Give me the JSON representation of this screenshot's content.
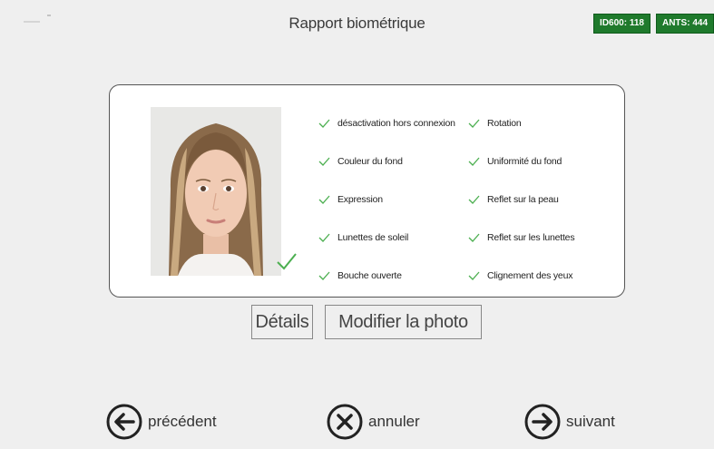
{
  "header": {
    "title": "Rapport biométrique",
    "badges": [
      "ID600: 118",
      "ANTS: 444"
    ]
  },
  "photo": {
    "alt": "portrait-photo",
    "validated": true
  },
  "checks": [
    "désactivation hors connexion",
    "Rotation",
    "Couleur du fond",
    "Uniformité du fond",
    "Expression",
    "Reflet sur la peau",
    "Lunettes de soleil",
    "Reflet sur les lunettes",
    "Bouche ouverte",
    "Clignement des yeux"
  ],
  "actions": {
    "details_label": "Détails",
    "modify_label": "Modifier la photo"
  },
  "nav": {
    "prev_label": "précédent",
    "cancel_label": "annuler",
    "next_label": "suivant"
  },
  "colors": {
    "accent_green": "#1f7a2c",
    "check_green": "#4caf50",
    "background": "#efefef"
  },
  "icons": {
    "prev": "arrow-left-circle-icon",
    "cancel": "x-circle-icon",
    "next": "arrow-right-circle-icon",
    "check": "checkmark-icon"
  }
}
